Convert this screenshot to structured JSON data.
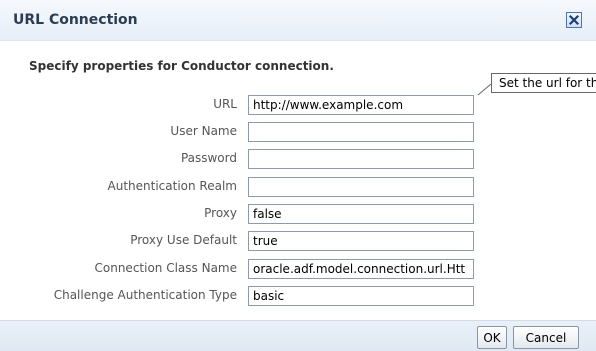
{
  "dialog": {
    "title": "URL Connection",
    "close_icon": "close-x-icon"
  },
  "form": {
    "heading": "Specify properties for Conductor connection.",
    "tooltip": "Set the url for th",
    "fields": [
      {
        "label": "URL",
        "value": "http://www.example.com"
      },
      {
        "label": "User Name",
        "value": ""
      },
      {
        "label": "Password",
        "value": ""
      },
      {
        "label": "Authentication Realm",
        "value": ""
      },
      {
        "label": "Proxy",
        "value": "false"
      },
      {
        "label": "Proxy Use Default",
        "value": "true"
      },
      {
        "label": "Connection Class Name",
        "value": "oracle.adf.model.connection.url.Htt"
      },
      {
        "label": "Challenge Authentication Type",
        "value": "basic"
      }
    ]
  },
  "footer": {
    "ok_label": "OK",
    "cancel_label": "Cancel"
  },
  "colors": {
    "title_text": "#2c3c52",
    "header_gradient_top": "#f6f9fd",
    "header_gradient_bottom": "#e6eef8",
    "close_button_border": "#4a76b8"
  }
}
